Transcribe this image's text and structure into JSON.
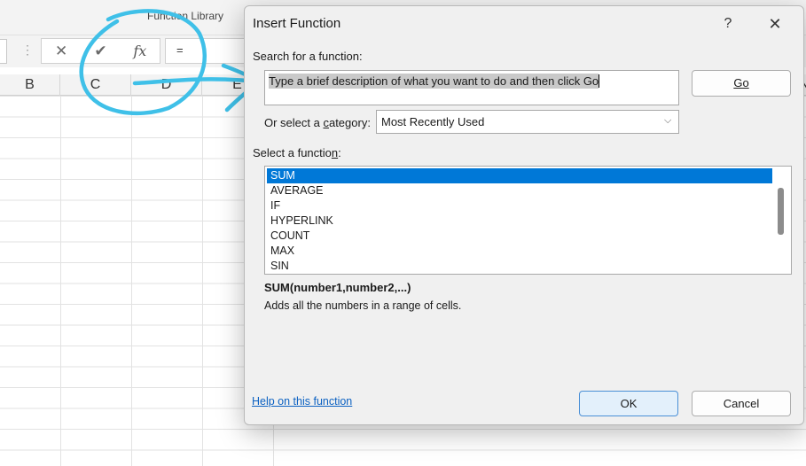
{
  "ribbon": {
    "group_label": "Function Library"
  },
  "formula_bar": {
    "dots": "⋮",
    "cancel_glyph": "✕",
    "enter_glyph": "✔",
    "fx_glyph": "fx",
    "value": "="
  },
  "columns": [
    "B",
    "C",
    "D",
    "E"
  ],
  "edge_column": "N",
  "dialog": {
    "title": "Insert Function",
    "help_glyph": "?",
    "close_glyph": "✕",
    "search_label_pre": "Search for a function:",
    "search_value": "Type a brief description of what you want to do and then click Go",
    "go_label": "Go",
    "category_label_pre": "Or select a ",
    "category_label_key": "c",
    "category_label_post": "ategory:",
    "category_value": "Most Recently Used",
    "function_label_pre": "Select a functio",
    "function_label_key": "n",
    "function_label_post": ":",
    "functions": [
      "SUM",
      "AVERAGE",
      "IF",
      "HYPERLINK",
      "COUNT",
      "MAX",
      "SIN"
    ],
    "selected_function": "SUM",
    "signature": "SUM(number1,number2,...)",
    "description": "Adds all the numbers in a range of cells.",
    "help_link": "Help on this function",
    "ok_label": "OK",
    "cancel_label": "Cancel"
  },
  "colors": {
    "accent": "#0078d7",
    "annotation": "#3fc0e8",
    "link": "#0b61c2"
  }
}
